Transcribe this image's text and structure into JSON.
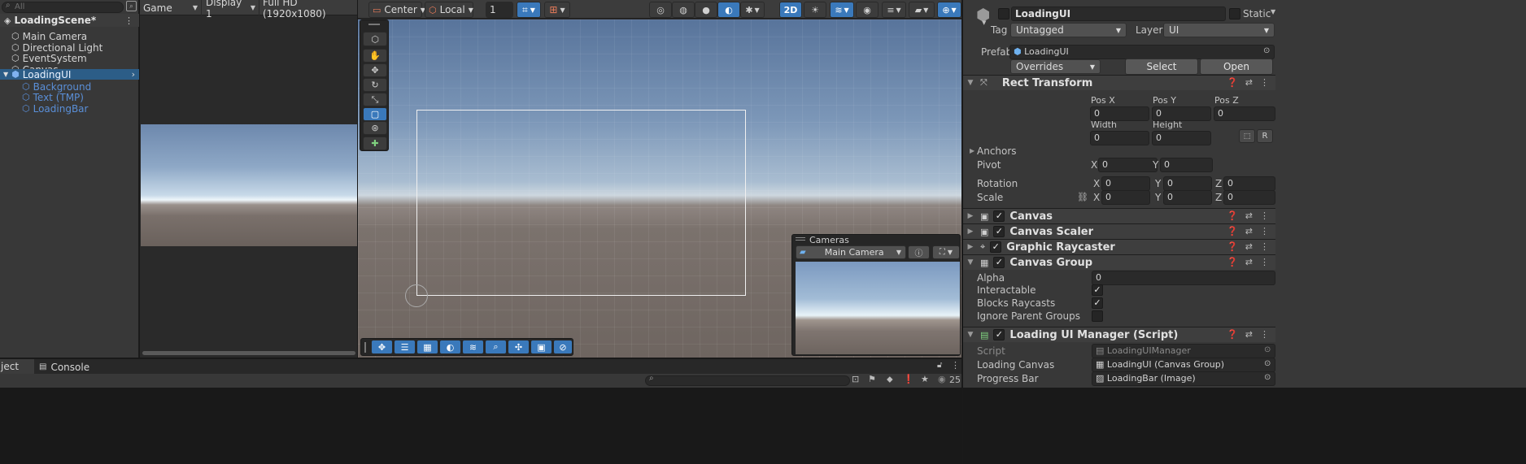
{
  "hierarchy": {
    "search_placeholder": "All",
    "scene_name": "LoadingScene*",
    "items": [
      {
        "label": "Main Camera"
      },
      {
        "label": "Directional Light"
      },
      {
        "label": "EventSystem"
      },
      {
        "label": "Canvas"
      },
      {
        "label": "LoadingUI"
      },
      {
        "label": "Background"
      },
      {
        "label": "Text (TMP)"
      },
      {
        "label": "LoadingBar"
      }
    ]
  },
  "game_view": {
    "tab_label": "Game",
    "display": "Display 1",
    "resolution": "Full HD (1920x1080)"
  },
  "scene_toolbar": {
    "pivot": "Center",
    "space": "Local",
    "grid_value": "1",
    "mode_2d": "2D"
  },
  "cameras_overlay": {
    "title": "Cameras",
    "selected_camera": "Main Camera"
  },
  "bottom_tabs": {
    "project_tab": "ject",
    "console_tab": "Console",
    "visible_count": "25"
  },
  "inspector": {
    "object_name": "LoadingUI",
    "static_label": "Static",
    "tag_label": "Tag",
    "tag_value": "Untagged",
    "layer_label": "Layer",
    "layer_value": "UI",
    "prefab_label": "Prefab",
    "prefab_value": "LoadingUI",
    "overrides_label": "Overrides",
    "select_label": "Select",
    "open_label": "Open",
    "rect_transform": {
      "title": "Rect Transform",
      "posx_label": "Pos X",
      "posx": "0",
      "posy_label": "Pos Y",
      "posy": "0",
      "posz_label": "Pos Z",
      "posz": "0",
      "width_label": "Width",
      "width": "0",
      "height_label": "Height",
      "height": "0",
      "r_button": "R",
      "anchors_label": "Anchors",
      "pivot_label": "Pivot",
      "pivot_x_label": "X",
      "pivot_x": "0",
      "pivot_y_label": "Y",
      "pivot_y": "0",
      "rotation_label": "Rotation",
      "rot_x_label": "X",
      "rot_x": "0",
      "rot_y_label": "Y",
      "rot_y": "0",
      "rot_z_label": "Z",
      "rot_z": "0",
      "scale_label": "Scale",
      "scale_x_label": "X",
      "scale_x": "0",
      "scale_y_label": "Y",
      "scale_y": "0",
      "scale_z_label": "Z",
      "scale_z": "0"
    },
    "components": {
      "canvas": "Canvas",
      "canvas_scaler": "Canvas Scaler",
      "graphic_raycaster": "Graphic Raycaster",
      "canvas_group": "Canvas Group"
    },
    "canvas_group": {
      "alpha_label": "Alpha",
      "alpha": "0",
      "interactable_label": "Interactable",
      "blocks_raycasts_label": "Blocks Raycasts",
      "ignore_parent_groups_label": "Ignore Parent Groups"
    },
    "script_component": {
      "title": "Loading UI Manager (Script)",
      "script_label": "Script",
      "script_value": "LoadingUIManager",
      "loading_canvas_label": "Loading Canvas",
      "loading_canvas_value": "LoadingUI (Canvas Group)",
      "progress_bar_label": "Progress Bar",
      "progress_bar_value": "LoadingBar (Image)"
    }
  },
  "colors": {
    "selection": "#2c5d87",
    "accent_blue": "#3a79bb",
    "prefab_child": "#5a8fd8"
  }
}
